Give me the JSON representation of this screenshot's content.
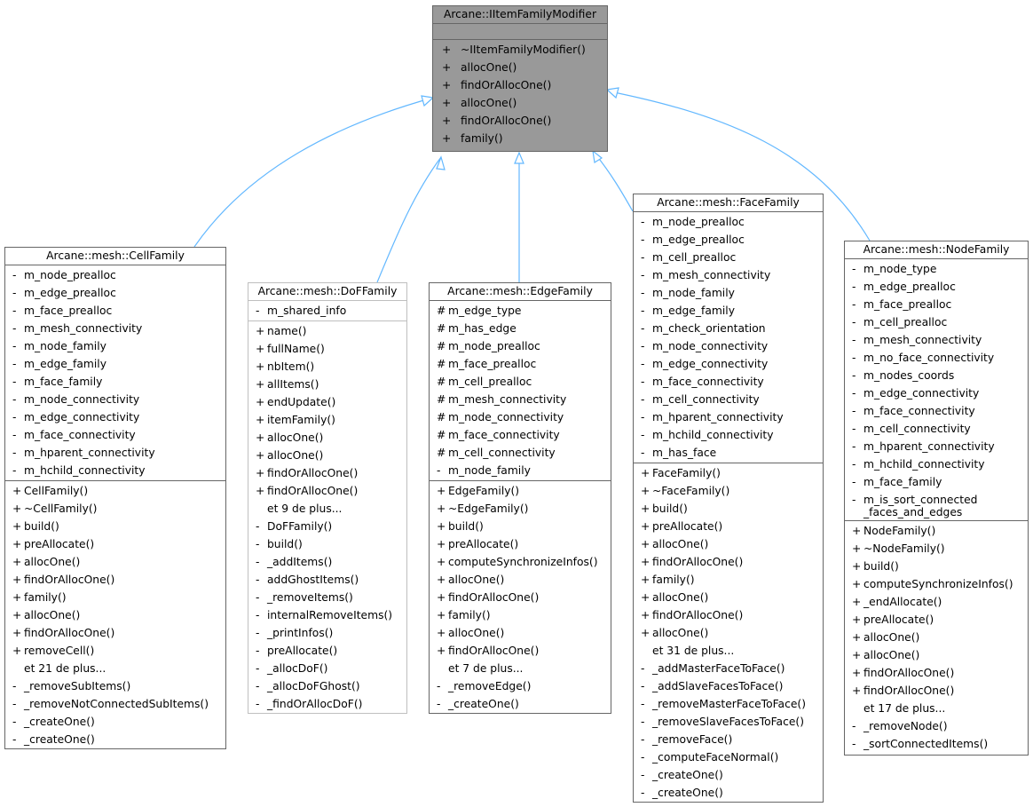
{
  "diagram": {
    "type": "class-inheritance",
    "edge_color": "#63b8ff",
    "base": {
      "name": "Arcane::IItemFamilyModifier",
      "attributes": [],
      "methods": [
        {
          "vis": "+",
          "name": "~IItemFamilyModifier()"
        },
        {
          "vis": "+",
          "name": "allocOne()"
        },
        {
          "vis": "+",
          "name": "findOrAllocOne()"
        },
        {
          "vis": "+",
          "name": "allocOne()"
        },
        {
          "vis": "+",
          "name": "findOrAllocOne()"
        },
        {
          "vis": "+",
          "name": "family()"
        }
      ]
    },
    "classes": [
      {
        "name": "Arcane::mesh::CellFamily",
        "attributes": [
          {
            "vis": "-",
            "name": "m_node_prealloc"
          },
          {
            "vis": "-",
            "name": "m_edge_prealloc"
          },
          {
            "vis": "-",
            "name": "m_face_prealloc"
          },
          {
            "vis": "-",
            "name": "m_mesh_connectivity"
          },
          {
            "vis": "-",
            "name": "m_node_family"
          },
          {
            "vis": "-",
            "name": "m_edge_family"
          },
          {
            "vis": "-",
            "name": "m_face_family"
          },
          {
            "vis": "-",
            "name": "m_node_connectivity"
          },
          {
            "vis": "-",
            "name": "m_edge_connectivity"
          },
          {
            "vis": "-",
            "name": "m_face_connectivity"
          },
          {
            "vis": "-",
            "name": "m_hparent_connectivity"
          },
          {
            "vis": "-",
            "name": "m_hchild_connectivity"
          }
        ],
        "methods": [
          {
            "vis": "+",
            "name": "CellFamily()"
          },
          {
            "vis": "+",
            "name": "~CellFamily()"
          },
          {
            "vis": "+",
            "name": "build()"
          },
          {
            "vis": "+",
            "name": "preAllocate()"
          },
          {
            "vis": "+",
            "name": "allocOne()"
          },
          {
            "vis": "+",
            "name": "findOrAllocOne()"
          },
          {
            "vis": "+",
            "name": "family()"
          },
          {
            "vis": "+",
            "name": "allocOne()"
          },
          {
            "vis": "+",
            "name": "findOrAllocOne()"
          },
          {
            "vis": "+",
            "name": "removeCell()"
          },
          {
            "vis": "",
            "name": "et 21 de plus..."
          },
          {
            "vis": "-",
            "name": "_removeSubItems()"
          },
          {
            "vis": "-",
            "name": "_removeNotConnectedSubItems()"
          },
          {
            "vis": "-",
            "name": "_createOne()"
          },
          {
            "vis": "-",
            "name": "_createOne()"
          }
        ]
      },
      {
        "name": "Arcane::mesh::DoFFamily",
        "attributes": [
          {
            "vis": "-",
            "name": "m_shared_info"
          }
        ],
        "methods": [
          {
            "vis": "+",
            "name": "name()"
          },
          {
            "vis": "+",
            "name": "fullName()"
          },
          {
            "vis": "+",
            "name": "nbItem()"
          },
          {
            "vis": "+",
            "name": "allItems()"
          },
          {
            "vis": "+",
            "name": "endUpdate()"
          },
          {
            "vis": "+",
            "name": "itemFamily()"
          },
          {
            "vis": "+",
            "name": "allocOne()"
          },
          {
            "vis": "+",
            "name": "allocOne()"
          },
          {
            "vis": "+",
            "name": "findOrAllocOne()"
          },
          {
            "vis": "+",
            "name": "findOrAllocOne()"
          },
          {
            "vis": "",
            "name": "et 9 de plus..."
          },
          {
            "vis": "-",
            "name": "DoFFamily()"
          },
          {
            "vis": "-",
            "name": "build()"
          },
          {
            "vis": "-",
            "name": "_addItems()"
          },
          {
            "vis": "-",
            "name": "addGhostItems()"
          },
          {
            "vis": "-",
            "name": "_removeItems()"
          },
          {
            "vis": "-",
            "name": "internalRemoveItems()"
          },
          {
            "vis": "-",
            "name": "_printInfos()"
          },
          {
            "vis": "-",
            "name": "preAllocate()"
          },
          {
            "vis": "-",
            "name": "_allocDoF()"
          },
          {
            "vis": "-",
            "name": "_allocDoFGhost()"
          },
          {
            "vis": "-",
            "name": "_findOrAllocDoF()"
          }
        ]
      },
      {
        "name": "Arcane::mesh::EdgeFamily",
        "attributes": [
          {
            "vis": "#",
            "name": "m_edge_type"
          },
          {
            "vis": "#",
            "name": "m_has_edge"
          },
          {
            "vis": "#",
            "name": "m_node_prealloc"
          },
          {
            "vis": "#",
            "name": "m_face_prealloc"
          },
          {
            "vis": "#",
            "name": "m_cell_prealloc"
          },
          {
            "vis": "#",
            "name": "m_mesh_connectivity"
          },
          {
            "vis": "#",
            "name": "m_node_connectivity"
          },
          {
            "vis": "#",
            "name": "m_face_connectivity"
          },
          {
            "vis": "#",
            "name": "m_cell_connectivity"
          },
          {
            "vis": "-",
            "name": "m_node_family"
          }
        ],
        "methods": [
          {
            "vis": "+",
            "name": "EdgeFamily()"
          },
          {
            "vis": "+",
            "name": "~EdgeFamily()"
          },
          {
            "vis": "+",
            "name": "build()"
          },
          {
            "vis": "+",
            "name": "preAllocate()"
          },
          {
            "vis": "+",
            "name": "computeSynchronizeInfos()"
          },
          {
            "vis": "+",
            "name": "allocOne()"
          },
          {
            "vis": "+",
            "name": "findOrAllocOne()"
          },
          {
            "vis": "+",
            "name": "family()"
          },
          {
            "vis": "+",
            "name": "allocOne()"
          },
          {
            "vis": "+",
            "name": "findOrAllocOne()"
          },
          {
            "vis": "",
            "name": "et 7 de plus..."
          },
          {
            "vis": "-",
            "name": "_removeEdge()"
          },
          {
            "vis": "-",
            "name": "_createOne()"
          }
        ]
      },
      {
        "name": "Arcane::mesh::FaceFamily",
        "attributes": [
          {
            "vis": "-",
            "name": "m_node_prealloc"
          },
          {
            "vis": "-",
            "name": "m_edge_prealloc"
          },
          {
            "vis": "-",
            "name": "m_cell_prealloc"
          },
          {
            "vis": "-",
            "name": "m_mesh_connectivity"
          },
          {
            "vis": "-",
            "name": "m_node_family"
          },
          {
            "vis": "-",
            "name": "m_edge_family"
          },
          {
            "vis": "-",
            "name": "m_check_orientation"
          },
          {
            "vis": "-",
            "name": "m_node_connectivity"
          },
          {
            "vis": "-",
            "name": "m_edge_connectivity"
          },
          {
            "vis": "-",
            "name": "m_face_connectivity"
          },
          {
            "vis": "-",
            "name": "m_cell_connectivity"
          },
          {
            "vis": "-",
            "name": "m_hparent_connectivity"
          },
          {
            "vis": "-",
            "name": "m_hchild_connectivity"
          },
          {
            "vis": "-",
            "name": "m_has_face"
          }
        ],
        "methods": [
          {
            "vis": "+",
            "name": "FaceFamily()"
          },
          {
            "vis": "+",
            "name": "~FaceFamily()"
          },
          {
            "vis": "+",
            "name": "build()"
          },
          {
            "vis": "+",
            "name": "preAllocate()"
          },
          {
            "vis": "+",
            "name": "allocOne()"
          },
          {
            "vis": "+",
            "name": "findOrAllocOne()"
          },
          {
            "vis": "+",
            "name": "family()"
          },
          {
            "vis": "+",
            "name": "allocOne()"
          },
          {
            "vis": "+",
            "name": "findOrAllocOne()"
          },
          {
            "vis": "+",
            "name": "allocOne()"
          },
          {
            "vis": "",
            "name": "et 31 de plus..."
          },
          {
            "vis": "-",
            "name": "_addMasterFaceToFace()"
          },
          {
            "vis": "-",
            "name": "_addSlaveFacesToFace()"
          },
          {
            "vis": "-",
            "name": "_removeMasterFaceToFace()"
          },
          {
            "vis": "-",
            "name": "_removeSlaveFacesToFace()"
          },
          {
            "vis": "-",
            "name": "_removeFace()"
          },
          {
            "vis": "-",
            "name": "_computeFaceNormal()"
          },
          {
            "vis": "-",
            "name": "_createOne()"
          },
          {
            "vis": "-",
            "name": "_createOne()"
          }
        ]
      },
      {
        "name": "Arcane::mesh::NodeFamily",
        "attributes": [
          {
            "vis": "-",
            "name": "m_node_type"
          },
          {
            "vis": "-",
            "name": "m_edge_prealloc"
          },
          {
            "vis": "-",
            "name": "m_face_prealloc"
          },
          {
            "vis": "-",
            "name": "m_cell_prealloc"
          },
          {
            "vis": "-",
            "name": "m_mesh_connectivity"
          },
          {
            "vis": "-",
            "name": "m_no_face_connectivity"
          },
          {
            "vis": "-",
            "name": "m_nodes_coords"
          },
          {
            "vis": "-",
            "name": "m_edge_connectivity"
          },
          {
            "vis": "-",
            "name": "m_face_connectivity"
          },
          {
            "vis": "-",
            "name": "m_cell_connectivity"
          },
          {
            "vis": "-",
            "name": "m_hparent_connectivity"
          },
          {
            "vis": "-",
            "name": "m_hchild_connectivity"
          },
          {
            "vis": "-",
            "name": "m_face_family"
          },
          {
            "vis": "-",
            "name": "m_is_sort_connected\n_faces_and_edges"
          }
        ],
        "methods": [
          {
            "vis": "+",
            "name": "NodeFamily()"
          },
          {
            "vis": "+",
            "name": "~NodeFamily()"
          },
          {
            "vis": "+",
            "name": "build()"
          },
          {
            "vis": "+",
            "name": "computeSynchronizeInfos()"
          },
          {
            "vis": "+",
            "name": "_endAllocate()"
          },
          {
            "vis": "+",
            "name": "preAllocate()"
          },
          {
            "vis": "+",
            "name": "allocOne()"
          },
          {
            "vis": "+",
            "name": "allocOne()"
          },
          {
            "vis": "+",
            "name": "findOrAllocOne()"
          },
          {
            "vis": "+",
            "name": "findOrAllocOne()"
          },
          {
            "vis": "",
            "name": "et 17 de plus..."
          },
          {
            "vis": "-",
            "name": "_removeNode()"
          },
          {
            "vis": "-",
            "name": "_sortConnectedItems()"
          }
        ]
      }
    ],
    "edges": [
      {
        "from": "Arcane::mesh::CellFamily",
        "to": "Arcane::IItemFamilyModifier",
        "kind": "inherits"
      },
      {
        "from": "Arcane::mesh::DoFFamily",
        "to": "Arcane::IItemFamilyModifier",
        "kind": "inherits"
      },
      {
        "from": "Arcane::mesh::EdgeFamily",
        "to": "Arcane::IItemFamilyModifier",
        "kind": "inherits"
      },
      {
        "from": "Arcane::mesh::FaceFamily",
        "to": "Arcane::IItemFamilyModifier",
        "kind": "inherits"
      },
      {
        "from": "Arcane::mesh::NodeFamily",
        "to": "Arcane::IItemFamilyModifier",
        "kind": "inherits"
      }
    ]
  }
}
